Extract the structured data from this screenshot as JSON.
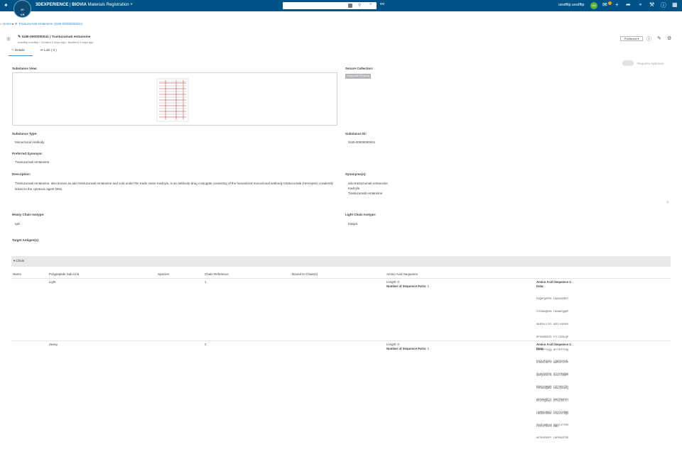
{
  "topbar": {
    "logo_glyph": "3DS",
    "brand": "3DEXPERIENCE",
    "separator": " | ",
    "brand2": "BIOVIA",
    "app": "Materials Registration",
    "compass_top": "3D",
    "compass_label": "V,R",
    "user": "uxsdfttp uxsdfttp",
    "avatar_initials": "UU",
    "icons": [
      "search-icon",
      "tag-icon",
      "notification-icon",
      "plus-icon",
      "share-icon",
      "network-icon",
      "tools-icon",
      "help-icon",
      "apps-icon"
    ]
  },
  "breadcrumb": {
    "home": "Home",
    "sep": "▸",
    "item": "Trastuzumab emtansine (SUB-00000000041)"
  },
  "header": {
    "title": "SUB-0000000041 | Trastuzumab emtansine",
    "subtitle": "uxsdfttp uxsdfttp / Created 2 days ago / Modified 3 days ago",
    "status": "Published ▾"
  },
  "tabs": [
    {
      "label": "Details"
    },
    {
      "label": "Lots ( 0 )"
    }
  ],
  "toggle": {
    "label": "Requires Approval"
  },
  "fields": {
    "substance_view_label": "Substance View:",
    "secure_collection_label": "Secure Collection:",
    "secure_collection_value": "Corporate Registry",
    "substance_type_label": "Substance Type:",
    "substance_type_value": "Monoclonal Antibody",
    "substance_id_label": "Substance ID:",
    "substance_id_value": "SUB-00000000041",
    "preferred_synonym_label": "Preferred Synonym:",
    "preferred_synonym_value": "Trastuzumab emtansine",
    "description_label": "Description:",
    "description_value": "Trastuzumab emtansine, also known as ado-trastuzumab emtansine and sold under the trade name Kadcyla, is an antibody-drug conjugate consisting of the humanized monoclonal antibody trastuzumab (Herceptin) covalently linked to the cytotoxic agent DM1.",
    "synonyms_label": "Synonyms(s):",
    "synonyms_values": [
      "ado-trastuzumab emtansine",
      "Kadcyla",
      "Trastuzumab emtansine"
    ],
    "heavy_chain_label": "Heavy Chain Isotype:",
    "heavy_chain_value": "IgG",
    "light_chain_label": "Light Chain Isotype:",
    "light_chain_value": "Kappa",
    "target_antigen_label": "Target Antigen(s):"
  },
  "chain": {
    "section_label": "▾  Chain",
    "columns": [
      "Name",
      "Polypeptide Sub.Unit",
      "Species",
      "Chain Reference",
      "Bound to Chain(s)",
      "Amino Acid Sequence"
    ],
    "rows": [
      {
        "name": "",
        "subunit": "Light",
        "species": "",
        "chain_ref": "1",
        "bound": "",
        "length": "Length: 0",
        "parts_label": "Number of Sequence Parts:",
        "parts_value": "1",
        "seq_title": "Amino Acid Sequence 1:",
        "seq_data_label": "Data:",
        "seq_lines": [
          "DIQMTQSPSS LSASVGDRVT",
          "ITCRASQDVN TAVAWYQQKP",
          "GKAPKLLIYS ASFLYSGVPS",
          "RFSGSRSGTD FTLTISSLQP",
          "EDFATYYCQQ HYTTPPTFGQ",
          "GTKVEIKRTV AAPSVFIFPP",
          "SDEQLKSGTA SVVCLLNNFY",
          "PREAKVQWKV DNALQSGNSQ",
          "ESVTEQDSKD STYSLSSTLT",
          "LSKADYEKHK VYACEVTHQG",
          "LSSPVTKSFN RGEC"
        ]
      },
      {
        "name": "",
        "subunit": "Heavy",
        "species": "",
        "chain_ref": "2",
        "bound": "",
        "length": "Length: 0",
        "parts_label": "Number of Sequence Parts:",
        "parts_value": "1",
        "seq_title": "Amino Acid Sequence 1:",
        "seq_data_label": "Data:",
        "seq_lines": [
          "EVQLVESGGG LVQPGGSLRL",
          "SCAASGFNIK DTYIHWVRQA",
          "PGKGLEWVAR IYPTNGYTRY",
          "ADSVKGRFTI SADTSKNTAY",
          "LQMNSLRAED TAVYYCSRWG",
          "GDGFYAMDYW GQGTLVTVSS",
          "ASTKGPSVFP LAPSSKSTSG"
        ]
      }
    ]
  }
}
